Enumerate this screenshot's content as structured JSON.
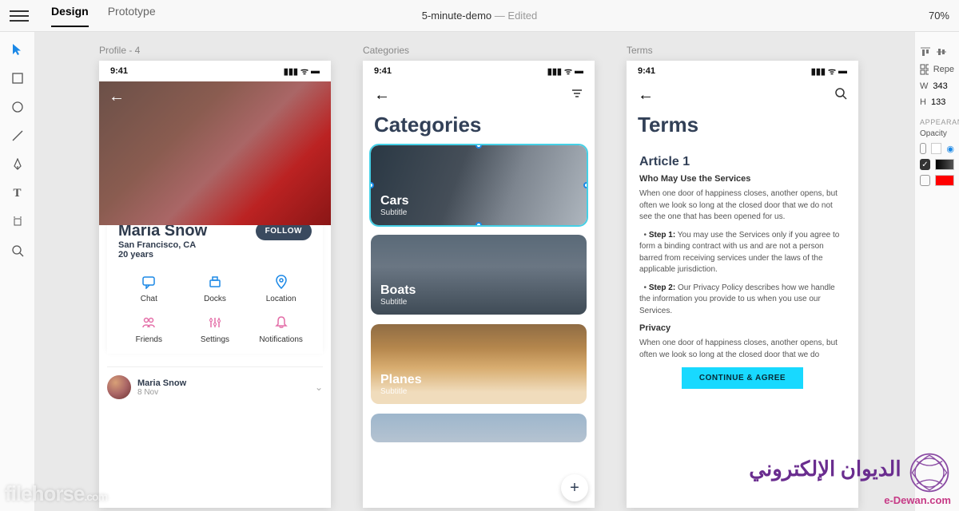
{
  "header": {
    "tabs": {
      "design": "Design",
      "prototype": "Prototype"
    },
    "doc_name": "5-minute-demo",
    "doc_status": "Edited",
    "zoom": "70%"
  },
  "tools": [
    "select",
    "rectangle",
    "ellipse",
    "line",
    "pen",
    "text",
    "artboard",
    "zoom"
  ],
  "artboards": {
    "profile": {
      "label": "Profile - 4",
      "status_time": "9:41",
      "name": "Maria Snow",
      "location": "San Francisco, CA",
      "age": "20 years",
      "follow": "FOLLOW",
      "grid": [
        {
          "icon": "chat",
          "label": "Chat",
          "color": "#1b88e6"
        },
        {
          "icon": "docks",
          "label": "Docks",
          "color": "#1b88e6"
        },
        {
          "icon": "location",
          "label": "Location",
          "color": "#1b88e6"
        },
        {
          "icon": "friends",
          "label": "Friends",
          "color": "#e46fa8"
        },
        {
          "icon": "settings",
          "label": "Settings",
          "color": "#e46fa8"
        },
        {
          "icon": "notifications",
          "label": "Notifications",
          "color": "#e46fa8"
        }
      ],
      "post": {
        "author": "Maria Snow",
        "date": "8 Nov"
      }
    },
    "categories": {
      "label": "Categories",
      "status_time": "9:41",
      "title": "Categories",
      "items": [
        {
          "title": "Cars",
          "subtitle": "Subtitle",
          "selected": true
        },
        {
          "title": "Boats",
          "subtitle": "Subtitle",
          "selected": false
        },
        {
          "title": "Planes",
          "subtitle": "Subtitle",
          "selected": false
        }
      ]
    },
    "terms": {
      "label": "Terms",
      "status_time": "9:41",
      "title": "Terms",
      "article": "Article 1",
      "h_services": "Who May Use the Services",
      "intro": "When one door of happiness closes, another opens, but often we look so long at the closed door that we do not see the one that has been opened for us.",
      "step1_label": "Step 1:",
      "step1": "You may use the Services only if you agree to form a binding contract with us and are not a person barred from receiving services under the laws of the applicable jurisdiction.",
      "step2_label": "Step 2:",
      "step2": "Our Privacy Policy describes how we handle the information you provide to us when you use our Services.",
      "h_privacy": "Privacy",
      "privacy_p": "When one door of happiness closes, another opens, but often we look so long at the closed door that we do",
      "button": "CONTINUE & AGREE"
    }
  },
  "right_panel": {
    "repeat": "Repe",
    "w_label": "W",
    "w": "343",
    "h_label": "H",
    "h": "133",
    "section_appearance": "APPEARANC",
    "opacity_label": "Opacity",
    "fills": [
      {
        "checked": false,
        "color": "#ffffff"
      },
      {
        "checked": true,
        "color": "#000000"
      },
      {
        "checked": false,
        "color": "#ff0000"
      }
    ]
  },
  "overlays": {
    "filehorse": "filehorse",
    "filehorse_com": ".com",
    "arabic": "الديوان الإلكتروني",
    "edewan": "e-Dewan.com"
  }
}
